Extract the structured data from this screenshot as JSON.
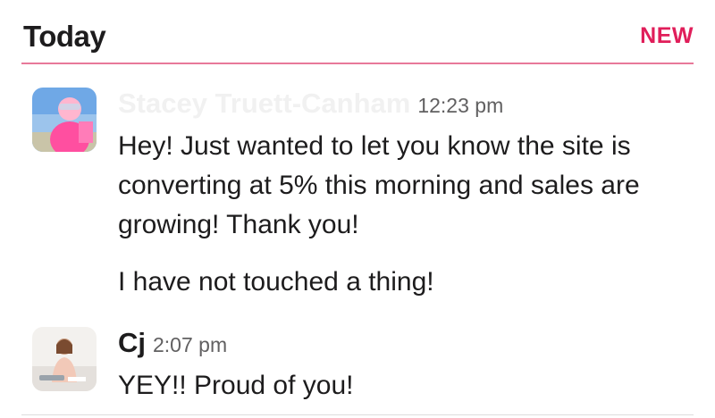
{
  "header": {
    "day": "Today",
    "new_badge": "NEW"
  },
  "messages": [
    {
      "sender": "Stacey Truett-Canham",
      "time": "12:23 pm",
      "paragraphs": [
        "Hey! Just wanted to let you know the site is converting at 5% this morning and sales are growing! Thank you!",
        "I have not touched a thing!"
      ]
    },
    {
      "sender": "Cj",
      "time": "2:07 pm",
      "paragraphs": [
        "YEY!! Proud of you!"
      ]
    }
  ],
  "colors": {
    "accent": "#e01e5a",
    "divider": "#e8799a",
    "text": "#1d1c1d",
    "muted": "#616061"
  }
}
